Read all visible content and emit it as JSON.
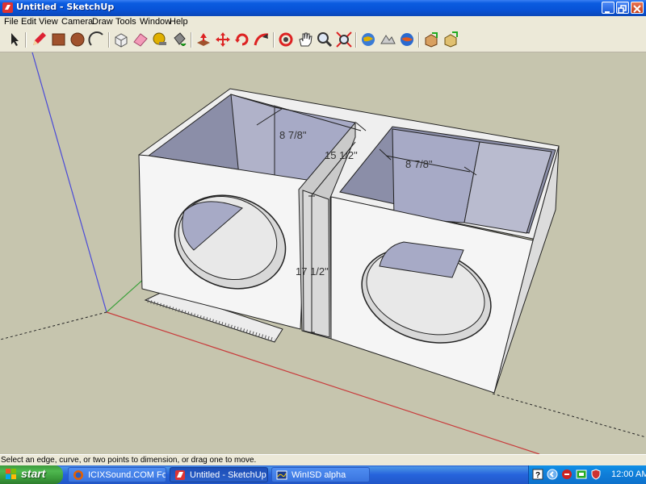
{
  "window": {
    "title": "Untitled - SketchUp"
  },
  "menu": [
    "File",
    "Edit",
    "View",
    "Camera",
    "Draw",
    "Tools",
    "Window",
    "Help"
  ],
  "toolbar": {
    "tools": [
      "select-icon",
      "pencil-icon",
      "rectangle-icon",
      "circle-icon",
      "arc-icon",
      "make-component-icon",
      "eraser-icon",
      "tape-measure-icon",
      "paint-bucket-icon",
      "push-pull-icon",
      "move-icon",
      "rotate-icon",
      "follow-me-icon",
      "orbit-icon",
      "pan-icon",
      "zoom-icon",
      "zoom-extents-icon",
      "add-location-icon",
      "toggle-terrain-icon",
      "get-models-icon",
      "share-model-icon",
      "share-component-icon"
    ]
  },
  "dimensions": {
    "left_width": "8 7/8\"",
    "right_width": "8 7/8\"",
    "top_depth": "15 1/2\"",
    "divider_height": "17 1/2\""
  },
  "status": {
    "text": "Select an edge, curve, or two points to dimension, or drag one to move."
  },
  "taskbar": {
    "start_label": "start",
    "tasks": [
      "ICIXSound.COM Foru...",
      "Untitled - SketchUp",
      "WinISD alpha"
    ],
    "clock": "12:00 AM"
  },
  "colors": {
    "viewport_bg": "#c6c5ae",
    "box_face": "#f5f5f5",
    "inner_back": "#a7aac6",
    "axis_red": "#c83c3c",
    "axis_green": "#3aa03a",
    "axis_blue": "#4a4ad8"
  }
}
